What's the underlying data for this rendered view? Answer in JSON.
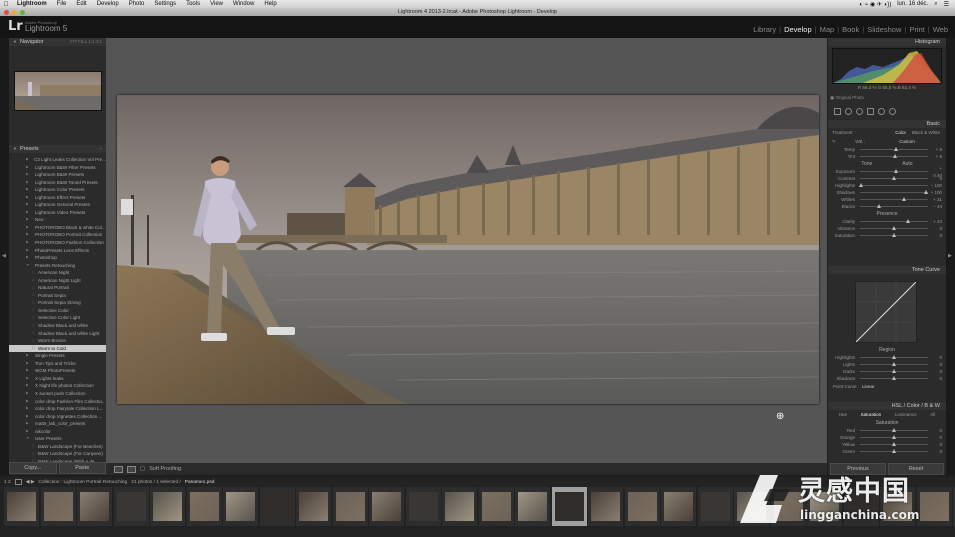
{
  "menubar": {
    "items": [
      "Lightroom",
      "File",
      "Edit",
      "Develop",
      "Photo",
      "Settings",
      "Tools",
      "View",
      "Window",
      "Help"
    ],
    "clock": "lun. 16 déc."
  },
  "window": {
    "title": "Lightroom 4 2013-2.lrcat - Adobe Photoshop Lightroom - Develop"
  },
  "identity": {
    "logo": "Lr",
    "small": "Adobe Photoshop",
    "name": "Lightroom 5"
  },
  "modules": [
    "Library",
    "Develop",
    "Map",
    "Book",
    "Slideshow",
    "Print",
    "Web"
  ],
  "active_module": "Develop",
  "left": {
    "navigator": {
      "title": "Navigator",
      "opts": "FIT  FILL  1:1  3:1"
    },
    "presets": {
      "title": "Presets"
    },
    "preset_items": [
      "C3 Light Leaks Collection Vol Pre...",
      "Lightroom B&W Filter Presets",
      "Lightroom B&W Presets",
      "Lightroom B&W Toned Presets",
      "Lightroom Color Presets",
      "Lightroom Effect Presets",
      "Lightroom General Presets",
      "Lightroom Video Presets",
      "Neo",
      "PHOTOROBO Black & white Col...",
      "PHOTOROBO Portrait Collection",
      "PHOTOROBO Fashion Collection",
      "PhotoPresets Lens Effects",
      "Photoshop",
      "Presets Retouching",
      "American Night",
      "American Night Light",
      "Natural Portrait",
      "Portrait Sepia",
      "Portrait Sepia Strong",
      "Selective Color",
      "Selective Color Light",
      "Shadow Black and white",
      "Shadow Black and white Light",
      "Warm Bronze",
      "Warm to Cold",
      "Single Presets",
      "Tom Tips and Tricks",
      "WCM PhotoPresets",
      "X Lights leaks",
      "X Night life photos Collection",
      "X sunset push Collection",
      "color drop Fashion Film Collectio...",
      "color drop Fairytale Collection L...",
      "color drop Vignettes Collection ...",
      "matte_lab_color_presets",
      "nikcolor",
      "User Presets",
      "B&W Landscape (For Beaches)",
      "B&W Landscape (For Canyons)",
      "B&W Landscape (With a de..."
    ],
    "selected_preset": "Warm to Cold",
    "copy": "Copy...",
    "paste": "Paste"
  },
  "toolbar": {
    "soft_proofing": "Soft Proofing"
  },
  "right": {
    "histogram_title": "Histogram",
    "histo_vals": "R  66,3  %    G  65,5  %    B  62,4  %",
    "original_photo": "Original Photo",
    "basic_title": "Basic",
    "treatment_label": "Treatment :",
    "treatment_color": "Color",
    "treatment_bw": "Black & White",
    "wb_label": "WB :",
    "wb_value": "Custom",
    "sliders_wb": [
      {
        "label": "Temp",
        "value": "+ 8"
      },
      {
        "label": "Tint",
        "value": "+ 6"
      }
    ],
    "tone_label": "Tone",
    "tone_auto": "Auto",
    "sliders_tone": [
      {
        "label": "Exposure",
        "value": "+ 0.40"
      },
      {
        "label": "Contrast",
        "value": "0"
      },
      {
        "label": "Highlights",
        "value": "− 100"
      },
      {
        "label": "Shadows",
        "value": "+ 100"
      },
      {
        "label": "Whites",
        "value": "+ 31"
      },
      {
        "label": "Blacks",
        "value": "− 44"
      }
    ],
    "presence_label": "Presence",
    "sliders_presence": [
      {
        "label": "Clarity",
        "value": "+ 43"
      },
      {
        "label": "Vibrance",
        "value": "0"
      },
      {
        "label": "Saturation",
        "value": "0"
      }
    ],
    "tone_curve_title": "Tone Curve",
    "region_label": "Region",
    "sliders_region": [
      {
        "label": "Highlights",
        "value": "0"
      },
      {
        "label": "Lights",
        "value": "0"
      },
      {
        "label": "Darks",
        "value": "0"
      },
      {
        "label": "Shadows",
        "value": "0"
      }
    ],
    "point_curve_label": "Point Curve :",
    "point_curve_value": "Linear",
    "hsl_title": "HSL  /  Color  /  B & W",
    "hsl_tabs": [
      "Hue",
      "Saturation",
      "Luminance",
      "All"
    ],
    "saturation_label": "Saturation",
    "sliders_sat": [
      {
        "label": "Red",
        "value": "0"
      },
      {
        "label": "Orange",
        "value": "0"
      },
      {
        "label": "Yellow",
        "value": "0"
      },
      {
        "label": "Green",
        "value": "0"
      }
    ],
    "previous": "Previous",
    "reset": "Reset"
  },
  "filmstrip": {
    "nums": "1   2",
    "path": "Collection : Lightroom Portrait Retouching",
    "count": "21 photos / 1 selected /",
    "file": "Paname1.psd"
  },
  "watermark": {
    "text": "灵感中国",
    "url": "lingganchina.com"
  },
  "colors": {
    "accent": "#eeeeee",
    "selected_row": "#c9c9c9",
    "panel": "#2b2b2b"
  }
}
